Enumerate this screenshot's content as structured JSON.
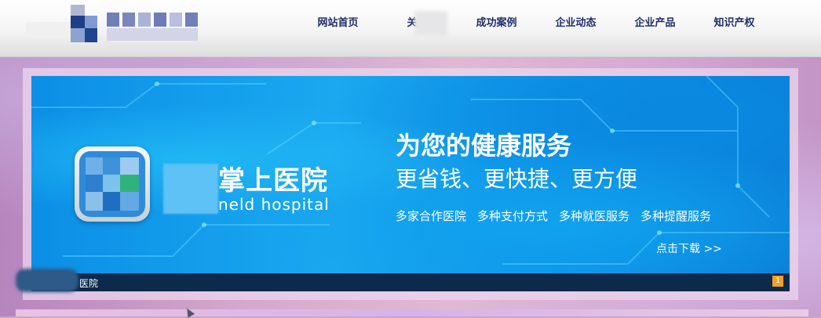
{
  "nav": {
    "items": [
      "网站首页",
      "关于",
      "成功案例",
      "企业动态",
      "企业产品",
      "知识产权"
    ]
  },
  "banner": {
    "brand_name": "掌上医院",
    "brand_en": "neld hospital",
    "slogan_main": "为您的健康服务",
    "slogan_sub": "更省钱、更快捷、更方便",
    "features": [
      "多家合作医院",
      "多种支付方式",
      "多种就医服务",
      "多种提醒服务"
    ],
    "download": "点击下载 >>",
    "caption": "医院",
    "page_number": "1"
  },
  "colors": {
    "nav_text": "#1f2e6b",
    "banner_blue": "#0b8fe6",
    "caption_bar": "#0c2a4c",
    "badge": "#f4a11e"
  }
}
